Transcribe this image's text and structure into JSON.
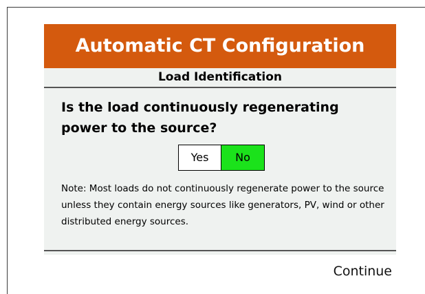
{
  "dialog": {
    "title": "Automatic CT Configuration",
    "subtitle": "Load Identification",
    "question": "Is the load continuously regenerating power to the source?",
    "options": {
      "yes_label": "Yes",
      "no_label": "No",
      "selected": "No"
    },
    "note": "Note: Most loads do not continuously regenerate power to the source unless they contain energy sources like generators, PV,  wind or other distributed energy sources."
  },
  "footer": {
    "continue_label": "Continue"
  },
  "colors": {
    "title_bar": "#d45a0e",
    "title_text": "#ffffff",
    "dialog_background": "#eff2f0",
    "selected_option": "#1be21b",
    "unselected_option": "#ffffff"
  }
}
